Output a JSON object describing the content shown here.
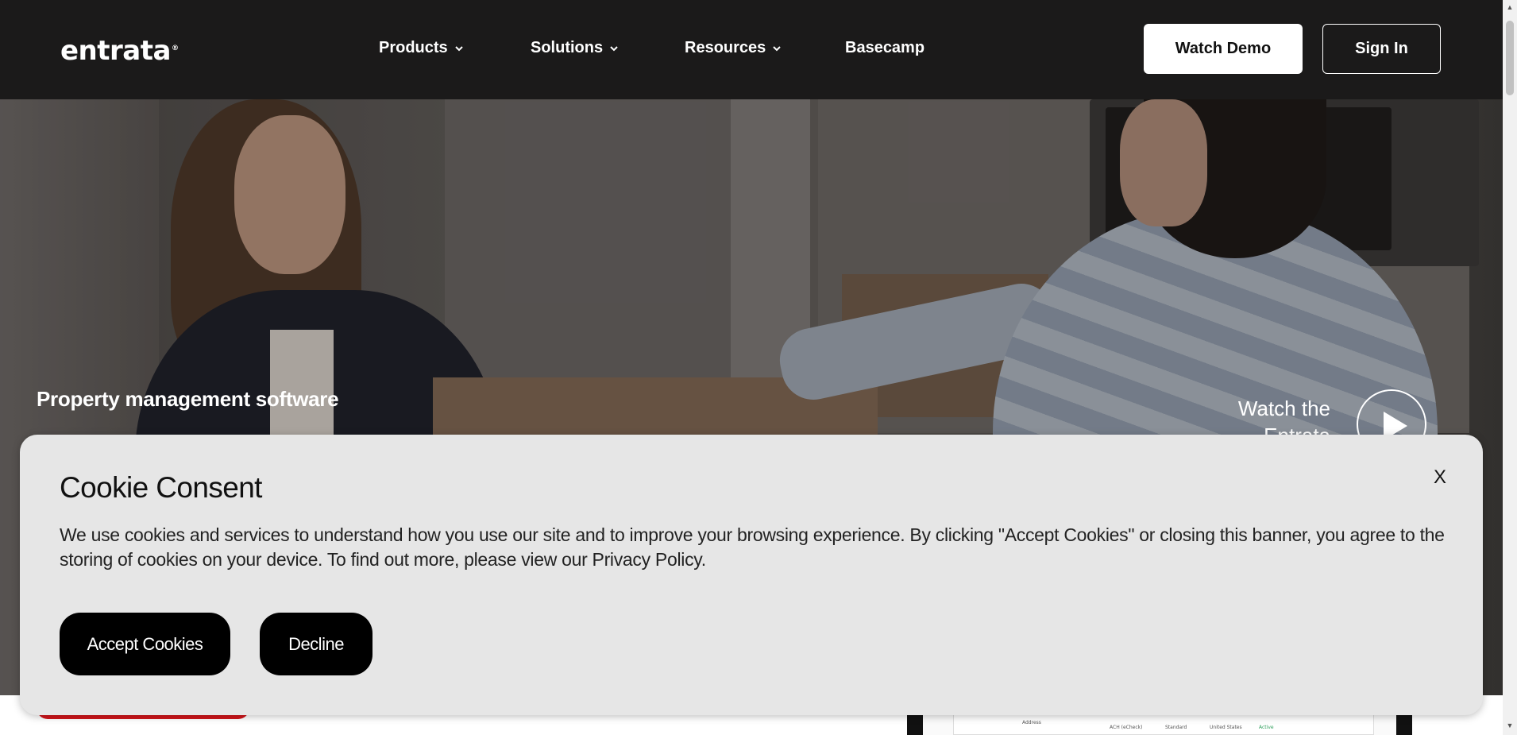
{
  "header": {
    "logo": "entrata",
    "logo_mark": "®",
    "nav": [
      {
        "label": "Products",
        "has_dropdown": true
      },
      {
        "label": "Solutions",
        "has_dropdown": true
      },
      {
        "label": "Resources",
        "has_dropdown": true
      },
      {
        "label": "Basecamp",
        "has_dropdown": false
      }
    ],
    "watch_demo_label": "Watch Demo",
    "sign_in_label": "Sign In"
  },
  "hero": {
    "title": "Property management software",
    "watch_line1": "Watch the",
    "watch_line2": "Entrata overview",
    "play_icon": "play-icon"
  },
  "cookie": {
    "title": "Cookie Consent",
    "text": "We use cookies and services to understand how you use our site and to improve your browsing experience. By clicking \"Accept Cookies\" or closing this banner, you agree to the storing of cookies on your device. To find out more, please view our Privacy Policy.",
    "close_label": "X",
    "accept_label": "Accept Cookies",
    "decline_label": "Decline"
  },
  "preview": {
    "address_label": "Address",
    "row_method": "ACH (eCheck)",
    "row_type": "Standard",
    "row_country": "United States",
    "row_status": "Active"
  },
  "colors": {
    "header_bg": "#1b1a1a",
    "cookie_bg": "#e6e6e6",
    "accent_red": "#d3151b",
    "status_green": "#2e9e5b"
  }
}
